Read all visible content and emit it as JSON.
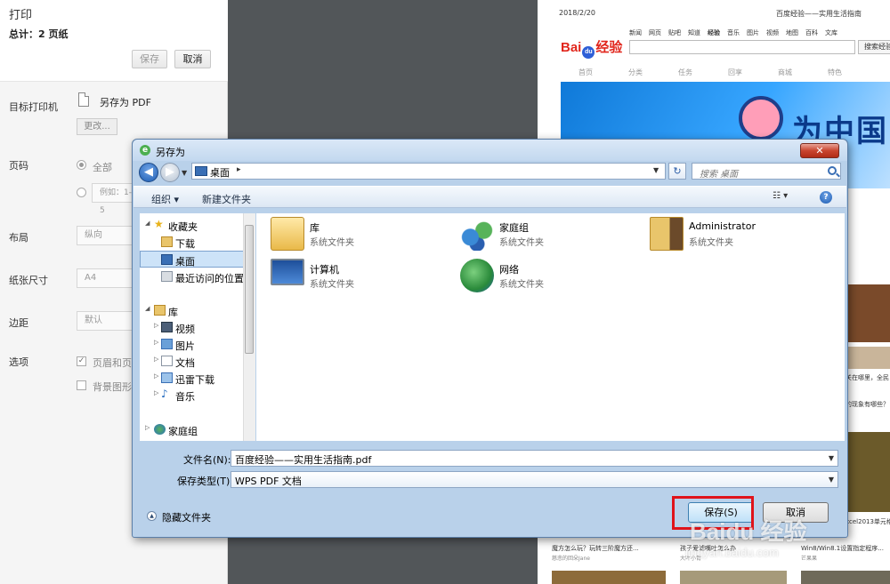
{
  "print_panel": {
    "title": "打印",
    "total": "总计：2 页纸",
    "save_label": "保存",
    "cancel_label": "取消",
    "destination_label": "目标打印机",
    "destination_value": "另存为 PDF",
    "change_label": "更改...",
    "pages_label": "页码",
    "pages_all": "全部",
    "pages_example": "例如：1-5",
    "layout_label": "布局",
    "layout_value": "纵向",
    "paper_label": "纸张尺寸",
    "paper_value": "A4",
    "margins_label": "边距",
    "margins_value": "默认",
    "options_label": "选项",
    "option_headers": "页眉和页脚",
    "option_background": "背景图形"
  },
  "preview": {
    "date": "2018/2/20",
    "page_title": "百度经验——实用生活指南",
    "nav": [
      "新闻",
      "网页",
      "贴吧",
      "知道",
      "经验",
      "音乐",
      "图片",
      "视频",
      "地图",
      "百科",
      "文库"
    ],
    "search_button": "搜索经验",
    "menu": [
      "首页",
      "分类",
      "任务",
      "回享",
      "商城",
      "特色"
    ],
    "banner_text": "为中国",
    "captions": [
      {
        "title": "魔方怎么玩？玩转三阶魔方还...",
        "sub": "慈悲的回朵Jane"
      },
      {
        "title": "孩子爱滤嘴吐怎么办",
        "sub": "大叶小青"
      },
      {
        "title": "Win8/Win8.1设置指定程序...",
        "sub": "芒果果"
      }
    ],
    "side_texts": [
      "关在哪里，全民",
      "的现象有哪些？",
      "xcel2013单元格"
    ]
  },
  "dialog": {
    "title": "另存为",
    "address": "桌面",
    "search_placeholder": "搜索 桌面",
    "organize_label": "组织 ▾",
    "new_folder_label": "新建文件夹",
    "nav_items": [
      {
        "label": "收藏夹",
        "icon": "star-icon"
      },
      {
        "label": "下载",
        "icon": "downloads-icon"
      },
      {
        "label": "桌面",
        "icon": "desktop-icon"
      },
      {
        "label": "最近访问的位置",
        "icon": "recent-icon"
      },
      {
        "label": "库",
        "icon": "library-icon"
      },
      {
        "label": "视频",
        "icon": "video-icon"
      },
      {
        "label": "图片",
        "icon": "pictures-icon"
      },
      {
        "label": "文档",
        "icon": "documents-icon"
      },
      {
        "label": "迅雷下载",
        "icon": "xunlei-icon"
      },
      {
        "label": "音乐",
        "icon": "music-icon"
      },
      {
        "label": "家庭组",
        "icon": "homegroup-icon"
      }
    ],
    "files": [
      {
        "name": "库",
        "type": "系统文件夹",
        "icon": "library-folder-icon"
      },
      {
        "name": "家庭组",
        "type": "系统文件夹",
        "icon": "homegroup-icon"
      },
      {
        "name": "Administrator",
        "type": "系统文件夹",
        "icon": "user-folder-icon"
      },
      {
        "name": "计算机",
        "type": "系统文件夹",
        "icon": "computer-icon"
      },
      {
        "name": "网络",
        "type": "系统文件夹",
        "icon": "network-icon"
      }
    ],
    "filename_label": "文件名(N):",
    "filename_value": "百度经验——实用生活指南.pdf",
    "filetype_label": "保存类型(T):",
    "filetype_value": "WPS PDF 文档",
    "hide_folders_label": "隐藏文件夹",
    "save_label": "保存(S)",
    "cancel_label": "取消",
    "annotation_color": "#e0131a"
  },
  "watermark": {
    "brand": "Baidu 经验",
    "url": "jingyan.baidu.com"
  }
}
